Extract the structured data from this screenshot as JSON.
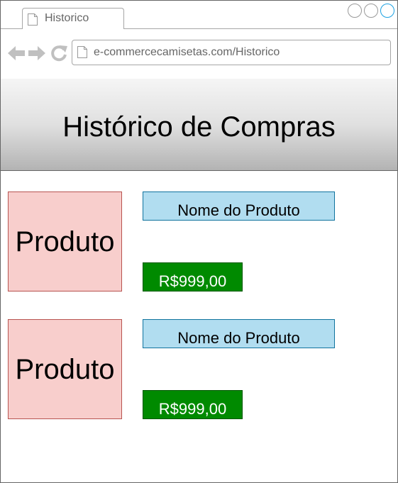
{
  "browser": {
    "tab_title": "Historico",
    "url": "e-commercecamisetas.com/Historico"
  },
  "header": {
    "title": "Histórico de Compras"
  },
  "purchases": [
    {
      "image_label": "Produto",
      "name": "Nome do Produto",
      "price": "R$999,00"
    },
    {
      "image_label": "Produto",
      "name": "Nome do Produto",
      "price": "R$999,00"
    }
  ],
  "colors": {
    "image_fill": "#f8cecc",
    "name_fill": "#b1ddf0",
    "price_fill": "#008a00",
    "accent": "#1ba1e2"
  },
  "icons": {
    "tab": "page-icon",
    "address": "page-icon",
    "nav": [
      "back-arrow-icon",
      "forward-arrow-icon",
      "refresh-icon"
    ],
    "window": [
      "minimize-icon",
      "maximize-icon",
      "close-icon"
    ]
  }
}
